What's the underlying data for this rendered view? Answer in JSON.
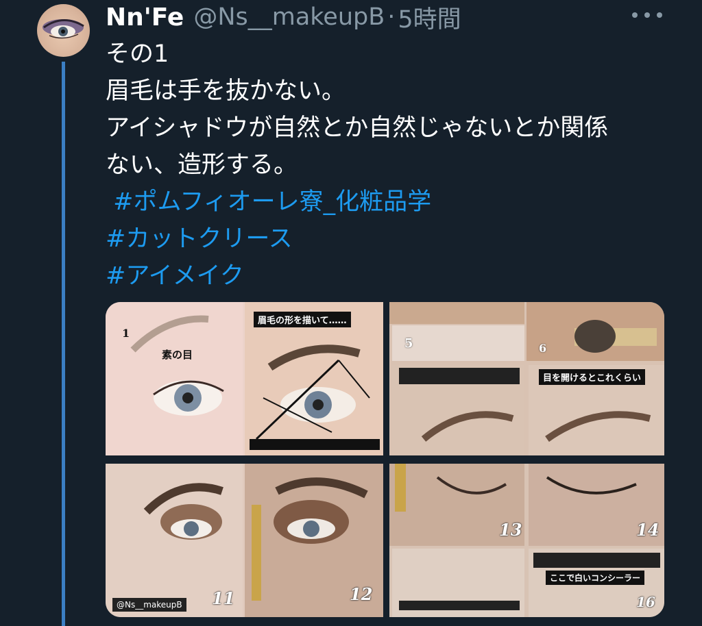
{
  "tweet": {
    "display_name": "Nn'Fe",
    "handle": "@Ns__makeupB",
    "separator": "·",
    "time": "5時間",
    "lines": [
      "その1",
      "眉毛は手を抜かない。",
      "アイシャドウが自然とか自然じゃないとか関係",
      "ない、造形する。"
    ],
    "hashtags": [
      " #ポムフィオーレ寮_化粧品学",
      "#カットクリース",
      "#アイメイク"
    ]
  },
  "media": {
    "panel1": {
      "num1": "1",
      "label1": "素の目",
      "label2": "眉毛の形を描いて……"
    },
    "panel2": {
      "num5": "5",
      "num6": "6",
      "label_open": "目を開けるとこれくらい"
    },
    "panel3": {
      "watermark": "@Ns__makeupB",
      "num11": "11",
      "num12": "12"
    },
    "panel4": {
      "num13": "13",
      "num14": "14",
      "label_concealer": "ここで白いコンシーラー",
      "num16": "16"
    }
  },
  "icons": {
    "more": "more-horizontal-icon",
    "avatar": "avatar-image"
  },
  "colors": {
    "background": "#15202b",
    "hashtag": "#1d9bf0",
    "secondary_text": "#8899a6",
    "thread_line": "#3b7fc4"
  }
}
